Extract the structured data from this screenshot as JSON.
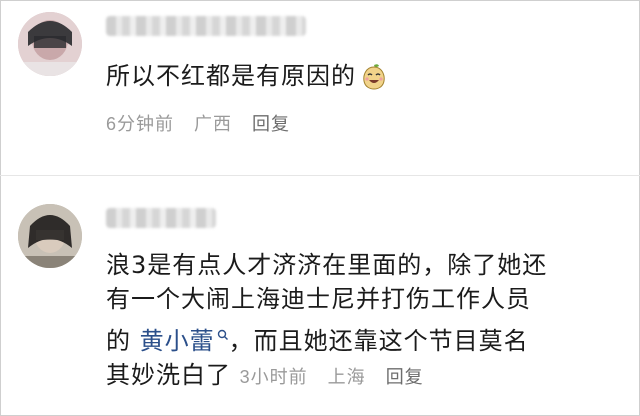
{
  "comments": [
    {
      "text": "所以不红都是有原因的",
      "emoji": "smiling-pear-emoji",
      "time": "6分钟前",
      "location": "广西",
      "reply": "回复"
    },
    {
      "lines": [
        "浪3是有点人才济济在里面的，除了她还",
        "有一个大闹上海迪士尼并打伤工作人员",
        "的 ",
        "，而且她还靠这个节目莫名",
        "其妙洗白了"
      ],
      "mention": "黄小蕾",
      "mention_icon": "search-icon",
      "time": "3小时前",
      "location": "上海",
      "reply": "回复"
    }
  ],
  "colors": {
    "mention": "#2b4f8a",
    "meta": "#9a9a9a",
    "text": "#1b1b1b"
  }
}
